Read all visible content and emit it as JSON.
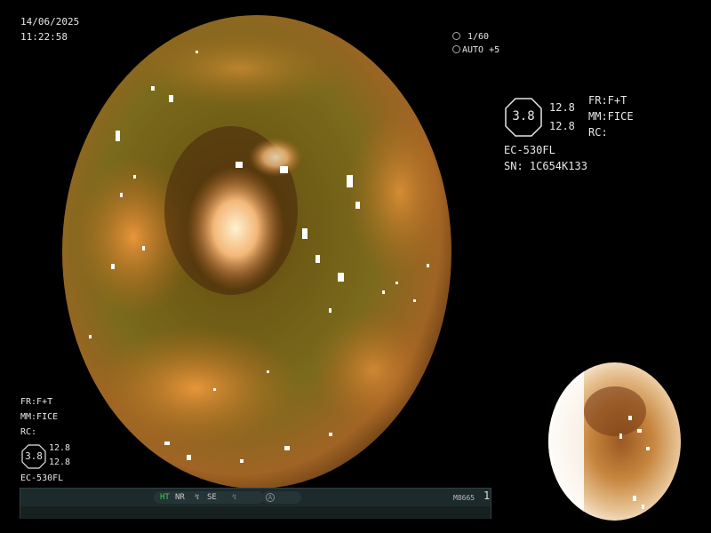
{
  "top_left": {
    "date": "14/06/2025",
    "time": "11:22:58"
  },
  "top_center": {
    "shutter": "1/60",
    "exposure": "AUTO +5"
  },
  "right_panel": {
    "badge_value": "3.8",
    "values": [
      "12.8",
      "12.8"
    ],
    "fr": "FR:F+T",
    "mm": "MM:FICE",
    "rc": "RC:",
    "model": "EC-530FL",
    "serial": "SN: 1C654K133"
  },
  "bottom_left_panel": {
    "fr": "FR:F+T",
    "mm": "MM:FICE",
    "rc": "RC:",
    "badge_value": "3.8",
    "values": [
      "12.8",
      "12.8"
    ],
    "model": "EC-530FL"
  },
  "status_bar": {
    "ht": "HT",
    "nr": "NR",
    "se": "SE",
    "code": "M8665",
    "page": "1"
  },
  "colors": {
    "ht_green": "#39d25a",
    "bar_bg": "#1c2a2c",
    "tissue_orange": "#c8782a"
  },
  "icons": [
    "shutter-icon",
    "auto-icon",
    "scope-icon",
    "flash-icon",
    "a-circle-icon"
  ]
}
